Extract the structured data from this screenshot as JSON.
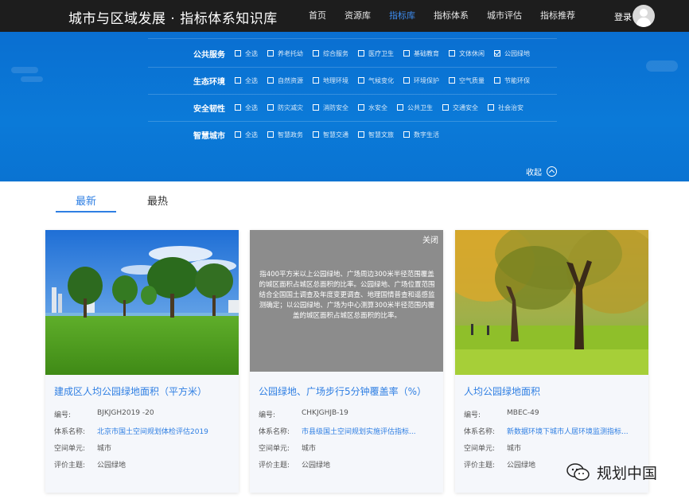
{
  "header": {
    "brand": "城市与区域发展 · 指标体系知识库",
    "nav": [
      {
        "label": "首页",
        "active": false
      },
      {
        "label": "资源库",
        "active": false
      },
      {
        "label": "指标库",
        "active": true
      },
      {
        "label": "指标体系",
        "active": false
      },
      {
        "label": "城市评估",
        "active": false
      },
      {
        "label": "指标推荐",
        "active": false
      }
    ],
    "login": "登录"
  },
  "filters": [
    {
      "label": "公共服务",
      "options": [
        {
          "label": "全选",
          "checked": false
        },
        {
          "label": "养老托幼",
          "checked": false
        },
        {
          "label": "综合服务",
          "checked": false
        },
        {
          "label": "医疗卫生",
          "checked": false
        },
        {
          "label": "基础教育",
          "checked": false
        },
        {
          "label": "文体休闲",
          "checked": false
        },
        {
          "label": "公园绿地",
          "checked": true
        }
      ]
    },
    {
      "label": "生态环境",
      "options": [
        {
          "label": "全选",
          "checked": false
        },
        {
          "label": "自然资源",
          "checked": false
        },
        {
          "label": "地理环境",
          "checked": false
        },
        {
          "label": "气候变化",
          "checked": false
        },
        {
          "label": "环境保护",
          "checked": false
        },
        {
          "label": "空气质量",
          "checked": false
        },
        {
          "label": "节能环保",
          "checked": false
        }
      ]
    },
    {
      "label": "安全韧性",
      "options": [
        {
          "label": "全选",
          "checked": false
        },
        {
          "label": "防灾减灾",
          "checked": false
        },
        {
          "label": "消防安全",
          "checked": false
        },
        {
          "label": "水安全",
          "checked": false
        },
        {
          "label": "公共卫生",
          "checked": false
        },
        {
          "label": "交通安全",
          "checked": false
        },
        {
          "label": "社会治安",
          "checked": false
        }
      ]
    },
    {
      "label": "智慧城市",
      "options": [
        {
          "label": "全选",
          "checked": false
        },
        {
          "label": "智慧政务",
          "checked": false
        },
        {
          "label": "智慧交通",
          "checked": false
        },
        {
          "label": "智慧文旅",
          "checked": false
        },
        {
          "label": "数字生活",
          "checked": false
        }
      ]
    }
  ],
  "collapse_label": "收起",
  "tabs": [
    {
      "label": "最新",
      "active": true
    },
    {
      "label": "最热",
      "active": false
    }
  ],
  "meta_keys": {
    "code": "编号:",
    "system": "体系名称:",
    "unit": "空间单元:",
    "theme": "评价主题:"
  },
  "cards": [
    {
      "title": "建成区人均公园绿地面积（平方米）",
      "code": "BJKJGH2019 -20",
      "system": "北京市国土空间规划体检评估2019",
      "unit": "城市",
      "theme": "公园绿地"
    },
    {
      "title": "公园绿地、广场步行5分钟覆盖率（%）",
      "code": "CHKJGHJB-19",
      "system": "市县级国土空间规划实施评估指标...",
      "unit": "城市",
      "theme": "公园绿地",
      "overlay_close": "关闭",
      "overlay_text": "指400平方米以上公园绿地、广场周边300米半径范围覆盖的城区面积占城区总面积的比率。公园绿地、广场位置范围结合全国国土调查及年度变更调查、地理国情普查和遥感监测确定；以公园绿地、广场为中心测算300米半径范围内覆盖的城区面积占城区总面积的比率。"
    },
    {
      "title": "人均公园绿地面积",
      "code": "MBEC-49",
      "system": "新数据环境下城市人居环境监测指标...",
      "unit": "城市",
      "theme": "公园绿地"
    }
  ],
  "watermark": "规划中国",
  "colors": {
    "topbar": "#1d1d1d",
    "banner": "#0b7ad8",
    "accent": "#2f7fe3",
    "overlay": "#8c8c8c"
  }
}
